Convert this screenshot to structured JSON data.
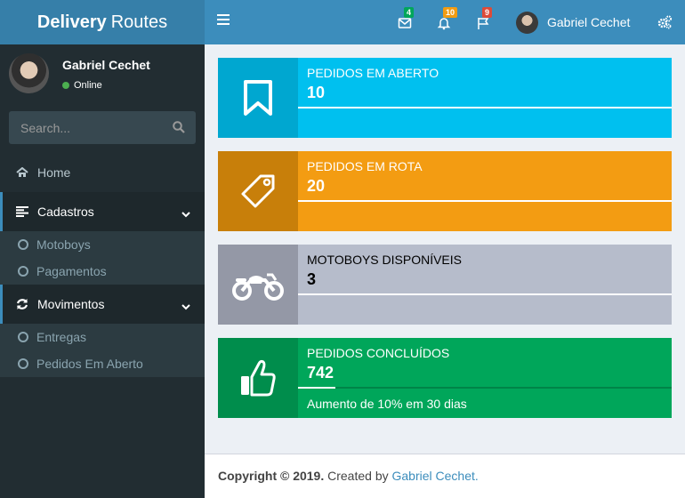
{
  "header": {
    "logo_bold": "Delivery",
    "logo_light": "Routes",
    "messages_count": "4",
    "notifications_count": "10",
    "tasks_count": "9",
    "user_name": "Gabriel Cechet"
  },
  "sidebar": {
    "user_name": "Gabriel Cechet",
    "user_status": "Online",
    "search_placeholder": "Search...",
    "home_label": "Home",
    "cadastros_label": "Cadastros",
    "cadastros_items": [
      "Motoboys",
      "Pagamentos"
    ],
    "movimentos_label": "Movimentos",
    "movimentos_items": [
      "Entregas",
      "Pedidos Em Aberto"
    ]
  },
  "boxes": [
    {
      "label": "PEDIDOS EM ABERTO",
      "value": "10",
      "progress_percent": 100,
      "description": "",
      "icon": "bookmark-icon"
    },
    {
      "label": "PEDIDOS EM ROTA",
      "value": "20",
      "progress_percent": 100,
      "description": "",
      "icon": "tag-icon"
    },
    {
      "label": "MOTOBOYS DISPONÍVEIS",
      "value": "3",
      "progress_percent": 100,
      "description": "",
      "icon": "motorcycle-icon"
    },
    {
      "label": "PEDIDOS CONCLUÍDOS",
      "value": "742",
      "progress_percent": 10,
      "description": "Aumento de 10% em 30 dias",
      "icon": "thumbs-up-icon"
    }
  ],
  "footer": {
    "copyright": "Copyright © 2019.",
    "created_by": "Created by",
    "author": "Gabriel Cechet."
  },
  "colors": {
    "header": "#3c8dbc",
    "logo": "#367fa9",
    "sidebar": "#222d32",
    "blue": "#00c0ef",
    "orange": "#f39c12",
    "gray": "#b6bccb",
    "green": "#00a65a"
  }
}
